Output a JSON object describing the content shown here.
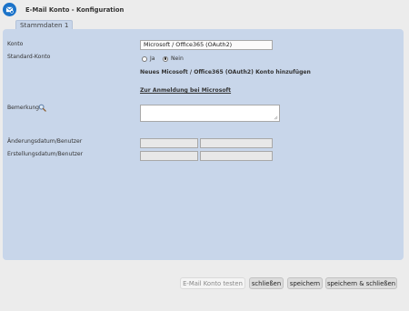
{
  "window": {
    "title": "E-Mail Konto - Konfiguration",
    "icon": "email-config-icon"
  },
  "tabs": [
    {
      "label": "Stammdaten 1",
      "active": true
    }
  ],
  "form": {
    "konto": {
      "label": "Konto",
      "value": "Microsoft / Office365 (OAuth2)"
    },
    "standard_konto": {
      "label": "Standard-Konto",
      "options": [
        {
          "label": "Ja",
          "selected": false
        },
        {
          "label": "Nein",
          "selected": true
        }
      ]
    },
    "info_text": "Neues Micosoft / Office365 (OAuth2) Konto hinzufügen",
    "login_link": "Zur Anmeldung bei Microsoft",
    "bemerkung": {
      "label": "Bemerkung",
      "value": "",
      "icon": "magnifier-icon"
    },
    "aenderung": {
      "label": "Änderungsdatum/Benutzer",
      "date": "",
      "user": ""
    },
    "erstellung": {
      "label": "Erstellungsdatum/Benutzer",
      "date": "",
      "user": ""
    }
  },
  "buttons": {
    "test": "E-Mail Konto testen",
    "close": "schließen",
    "save": "speichern",
    "save_close": "speichern & schließen"
  },
  "colors": {
    "panel": "#c8d6ea",
    "app_icon": "#1b73c9",
    "background": "#ececec"
  }
}
